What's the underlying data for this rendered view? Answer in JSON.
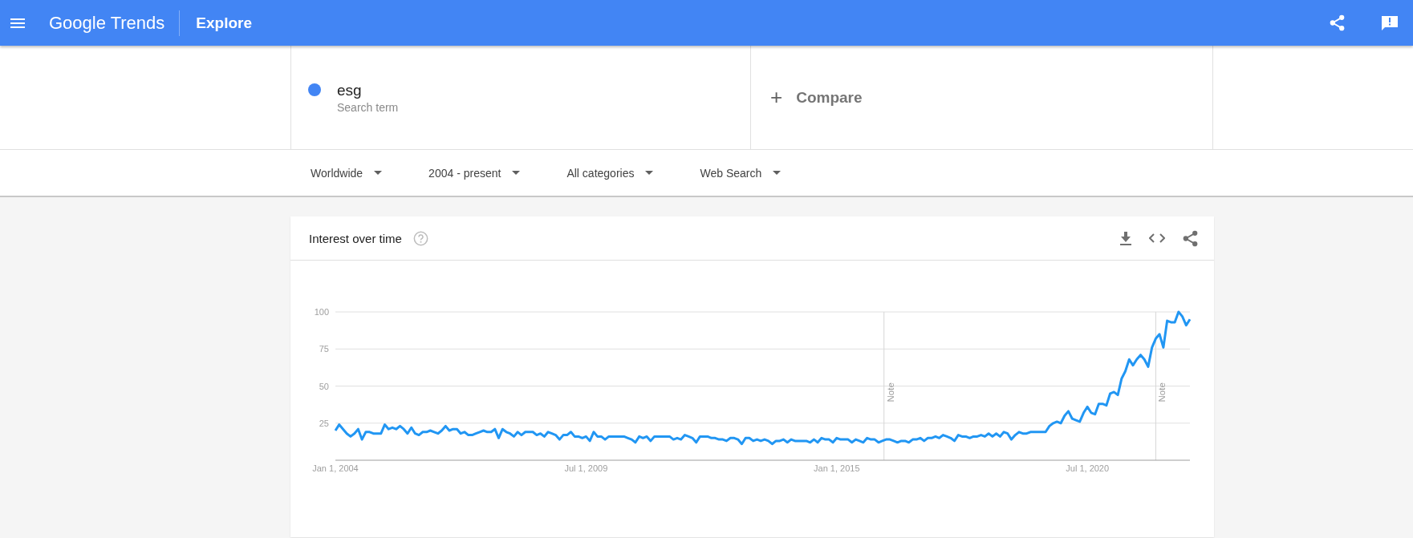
{
  "header": {
    "logo": "Google Trends",
    "title": "Explore"
  },
  "search_terms": [
    {
      "term": "esg",
      "subtitle": "Search term",
      "color": "#4285f4"
    }
  ],
  "compare": {
    "label": "Compare",
    "icon": "+"
  },
  "filters": [
    {
      "label": "Worldwide"
    },
    {
      "label": "2004 - present"
    },
    {
      "label": "All categories"
    },
    {
      "label": "Web Search"
    }
  ],
  "card": {
    "title": "Interest over time",
    "chart_data": {
      "type": "line",
      "categories": [
        "Jan 1, 2004",
        null,
        null,
        null,
        null,
        null,
        null,
        null,
        null,
        null,
        null,
        null,
        null,
        null,
        null,
        null,
        null,
        null,
        null,
        null,
        null,
        null,
        null,
        null,
        null,
        null,
        null,
        null,
        null,
        null,
        null,
        null,
        null,
        null,
        null,
        null,
        null,
        null,
        null,
        null,
        null,
        null,
        null,
        null,
        null,
        null,
        null,
        null,
        null,
        null,
        null,
        null,
        null,
        null,
        null,
        null,
        null,
        null,
        null,
        null,
        null,
        null,
        null,
        null,
        null,
        null,
        "Jul 1, 2009",
        null,
        null,
        null,
        null,
        null,
        null,
        null,
        null,
        null,
        null,
        null,
        null,
        null,
        null,
        null,
        null,
        null,
        null,
        null,
        null,
        null,
        null,
        null,
        null,
        null,
        null,
        null,
        null,
        null,
        null,
        null,
        null,
        null,
        null,
        null,
        null,
        null,
        null,
        null,
        null,
        null,
        null,
        null,
        null,
        null,
        null,
        null,
        null,
        null,
        null,
        null,
        null,
        null,
        null,
        null,
        null,
        null,
        null,
        null,
        null,
        null,
        null,
        null,
        null,
        null,
        "Jan 1, 2015",
        null,
        null,
        null,
        null,
        null,
        null,
        null,
        null,
        null,
        null,
        null,
        null,
        null,
        null,
        null,
        null,
        null,
        null,
        null,
        null,
        null,
        null,
        null,
        null,
        null,
        null,
        null,
        null,
        null,
        null,
        null,
        null,
        null,
        null,
        null,
        null,
        null,
        null,
        null,
        null,
        null,
        null,
        null,
        null,
        null,
        null,
        null,
        null,
        null,
        null,
        null,
        null,
        null,
        null,
        null,
        null,
        null,
        null,
        null,
        null,
        null,
        null,
        null,
        null,
        null,
        "Jul 1, 2020",
        null,
        null,
        null,
        null,
        null,
        null,
        null,
        null,
        null,
        null,
        null,
        null,
        null,
        null,
        null,
        null,
        null,
        null,
        null,
        null,
        null,
        null,
        null,
        null,
        null,
        null,
        null
      ],
      "series": [
        {
          "color": "#2196f3",
          "values": [
            20,
            24,
            21,
            18,
            16,
            18,
            21,
            14,
            19,
            19,
            18,
            18,
            18,
            24,
            21,
            22,
            21,
            23,
            21,
            18,
            22,
            18,
            17,
            19,
            19,
            20,
            19,
            18,
            20,
            23,
            20,
            21,
            21,
            18,
            19,
            17,
            17,
            18,
            19,
            20,
            19,
            19,
            21,
            15,
            21,
            19,
            18,
            16,
            19,
            17,
            19,
            19,
            19,
            17,
            18,
            16,
            19,
            18,
            17,
            14,
            17,
            17,
            19,
            16,
            16,
            15,
            16,
            13,
            19,
            16,
            16,
            14,
            16,
            16,
            16,
            16,
            16,
            15,
            14,
            12,
            16,
            15,
            16,
            13,
            16,
            16,
            16,
            16,
            16,
            14,
            15,
            14,
            17,
            16,
            15,
            12,
            16,
            16,
            16,
            15,
            15,
            14,
            14,
            13,
            15,
            15,
            14,
            11,
            15,
            15,
            13,
            14,
            13,
            14,
            13,
            11,
            13,
            13,
            14,
            12,
            14,
            13,
            13,
            13,
            13,
            12,
            14,
            12,
            15,
            14,
            14,
            12,
            15,
            14,
            14,
            14,
            12,
            14,
            13,
            12,
            15,
            14,
            14,
            12,
            13,
            14,
            14,
            13,
            12,
            13,
            13,
            12,
            14,
            14,
            15,
            13,
            15,
            15,
            16,
            15,
            17,
            16,
            15,
            13,
            17,
            16,
            16,
            15,
            16,
            16,
            17,
            16,
            18,
            16,
            18,
            16,
            19,
            18,
            14,
            17,
            19,
            18,
            18,
            19,
            19,
            19,
            19,
            19,
            23,
            25,
            26,
            25,
            30,
            33,
            28,
            27,
            26,
            32,
            36,
            32,
            31,
            38,
            38,
            37,
            45,
            46,
            44,
            55,
            60,
            68,
            64,
            68,
            71,
            68,
            63,
            76,
            82,
            85,
            76,
            94,
            93,
            93,
            100,
            97,
            91,
            95
          ]
        }
      ],
      "ylim": [
        0,
        100
      ],
      "yticks": [
        25,
        50,
        75,
        100
      ],
      "grid": true,
      "annotations": [
        "Note",
        "Note"
      ]
    }
  }
}
